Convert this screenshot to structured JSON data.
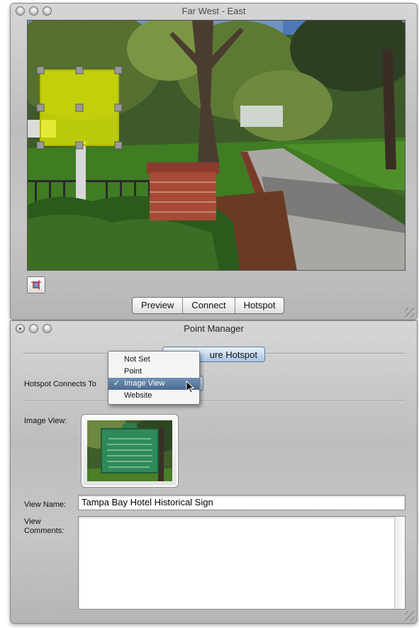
{
  "viewer_window": {
    "title": "Far West - East",
    "tabs": [
      "Preview",
      "Connect",
      "Hotspot"
    ]
  },
  "point_manager": {
    "title": "Point Manager",
    "configure_button": "ure Hotspot",
    "connects_label": "Hotspot Connects To",
    "connects_menu": {
      "options": [
        "Not Set",
        "Point",
        "Image View",
        "Website"
      ],
      "selected": "Image View"
    },
    "image_view_label": "Image View:",
    "view_name_label": "View Name:",
    "view_name_value": "Tampa Bay Hotel Historical Sign",
    "view_comments_label_1": "View",
    "view_comments_label_2": "Comments:",
    "view_comments_value": ""
  },
  "colors": {
    "hotspot_fill": "#e6f000",
    "selection_blue": "#55759e",
    "metal": "#c4c4c4"
  },
  "icons": [
    "hotspot-crop-icon",
    "checkmark-icon",
    "arrow-cursor-icon",
    "resize-grip-icon"
  ]
}
